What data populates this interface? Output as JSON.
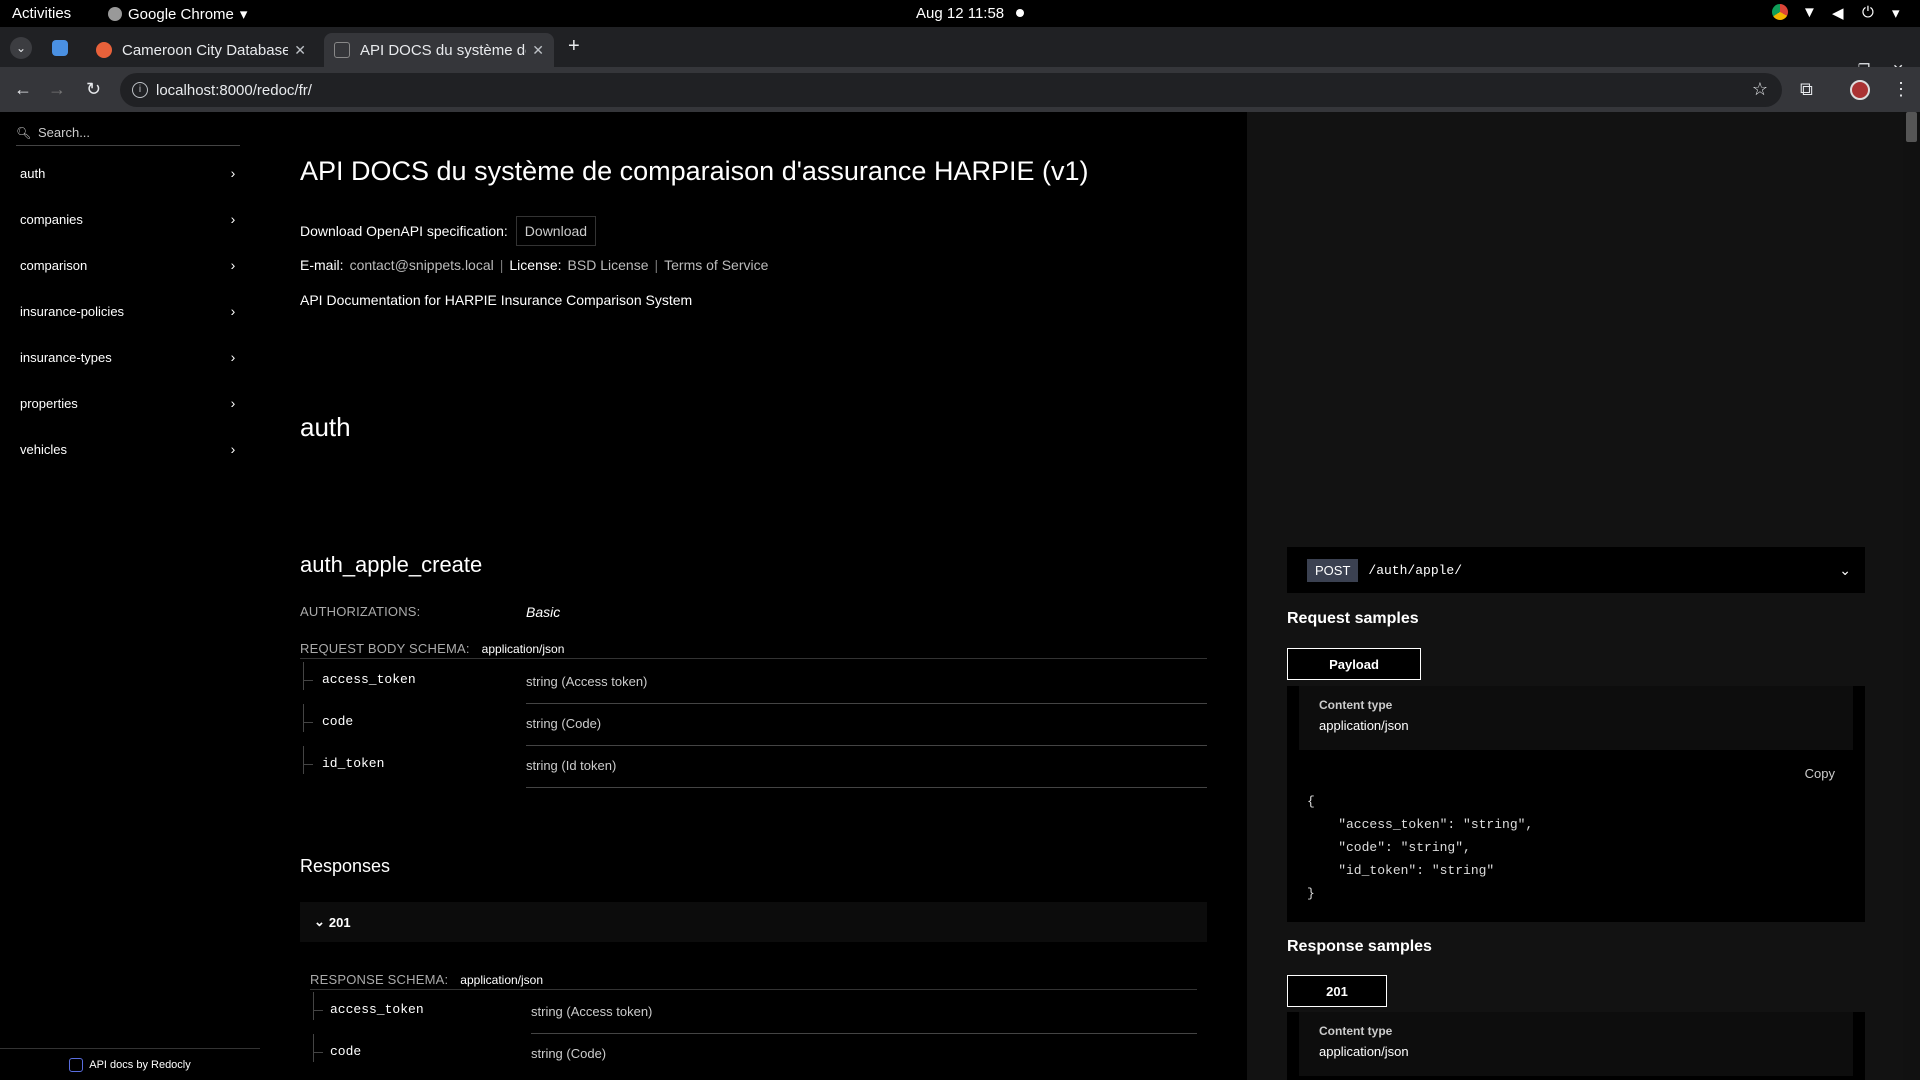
{
  "system": {
    "activities": "Activities",
    "app": "Google Chrome",
    "clock": "Aug 12  11:58"
  },
  "browser": {
    "tabs": [
      {
        "label": "Cameroon City Database"
      },
      {
        "label": "API DOCS du système de"
      }
    ],
    "url": "localhost:8000/redoc/fr/"
  },
  "sidebar": {
    "search_placeholder": "Search...",
    "items": [
      {
        "label": "auth"
      },
      {
        "label": "companies"
      },
      {
        "label": "comparison"
      },
      {
        "label": "insurance-policies"
      },
      {
        "label": "insurance-types"
      },
      {
        "label": "properties"
      },
      {
        "label": "vehicles"
      }
    ],
    "footer": "API docs by Redocly"
  },
  "main": {
    "title": "API DOCS du système de comparaison d'assurance HARPIE (v1)",
    "download_label": "Download OpenAPI specification:",
    "download_button": "Download",
    "email_label": "E-mail:",
    "email": "contact@snippets.local",
    "license_label": "License:",
    "license": "BSD License",
    "terms": "Terms of Service",
    "description": "API Documentation for HARPIE Insurance Comparison System",
    "section": "auth",
    "operation": "auth_apple_create",
    "authorizations_label": "AUTHORIZATIONS:",
    "authorizations_value": "Basic",
    "request_schema_label": "REQUEST BODY SCHEMA:",
    "request_schema_type": "application/json",
    "fields": [
      {
        "name": "access_token",
        "type": "string (Access token)"
      },
      {
        "name": "code",
        "type": "string (Code)"
      },
      {
        "name": "id_token",
        "type": "string (Id token)"
      }
    ],
    "responses_title": "Responses",
    "response_code": "201",
    "response_schema_label": "RESPONSE SCHEMA:",
    "response_schema_type": "application/json",
    "response_fields": [
      {
        "name": "access_token",
        "type": "string (Access token)"
      },
      {
        "name": "code",
        "type": "string (Code)"
      }
    ]
  },
  "right": {
    "method": "POST",
    "path": "/auth/apple/",
    "request_samples": "Request samples",
    "payload_tab": "Payload",
    "content_type_label": "Content type",
    "content_type_value": "application/json",
    "copy": "Copy",
    "code_lines": [
      "{",
      "    \"access_token\": \"string\",",
      "    \"code\": \"string\",",
      "    \"id_token\": \"string\"",
      "}"
    ],
    "response_samples": "Response samples",
    "response_tab": "201",
    "response_content_type_label": "Content type",
    "response_content_type_value": "application/json"
  }
}
